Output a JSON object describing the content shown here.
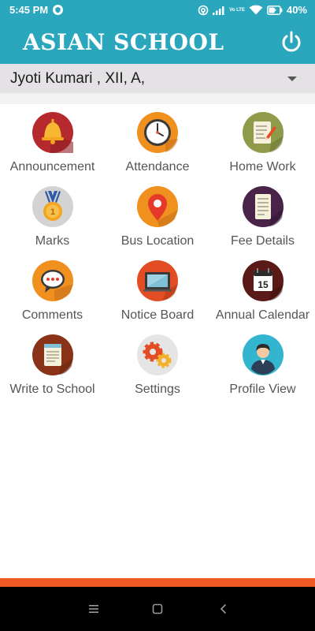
{
  "status_bar": {
    "time": "5:45 PM",
    "network": "Vo LTE",
    "battery": "40%",
    "icons": [
      "shield-icon",
      "hotspot-icon",
      "signal-icon",
      "wifi-icon",
      "battery-icon"
    ]
  },
  "app_bar": {
    "title": "ASIAN SCHOOL",
    "power_icon": "power-icon",
    "color": "#2aa6bd"
  },
  "student": {
    "label": "Jyoti Kumari , XII, A,"
  },
  "menu": [
    {
      "label": "Announcement",
      "icon": "bell-icon",
      "color": "#b5292f"
    },
    {
      "label": "Attendance",
      "icon": "clock-icon",
      "color": "#f0901e"
    },
    {
      "label": "Home Work",
      "icon": "notepad-pencil-icon",
      "color": "#8f9a4a"
    },
    {
      "label": "Marks",
      "icon": "medal-icon",
      "color": "#cfcfcf"
    },
    {
      "label": "Bus Location",
      "icon": "location-pin-icon",
      "color": "#f0901e"
    },
    {
      "label": "Fee Details",
      "icon": "receipt-icon",
      "color": "#4a2349"
    },
    {
      "label": "Comments",
      "icon": "speech-bubble-icon",
      "color": "#f0901e"
    },
    {
      "label": "Notice Board",
      "icon": "board-icon",
      "color": "#e34d24"
    },
    {
      "label": "Annual Calendar",
      "icon": "calendar-icon",
      "color": "#5a1a17"
    },
    {
      "label": "Write to School",
      "icon": "notebook-icon",
      "color": "#8a3318"
    },
    {
      "label": "Settings",
      "icon": "gears-icon",
      "color": "#e5e5e5"
    },
    {
      "label": "Profile View",
      "icon": "user-profile-icon",
      "color": "#33b5cf"
    }
  ],
  "calendar_day": "15",
  "accent_strip_color": "#ef5a24",
  "nav": [
    "menu-icon",
    "home-icon",
    "back-icon"
  ]
}
